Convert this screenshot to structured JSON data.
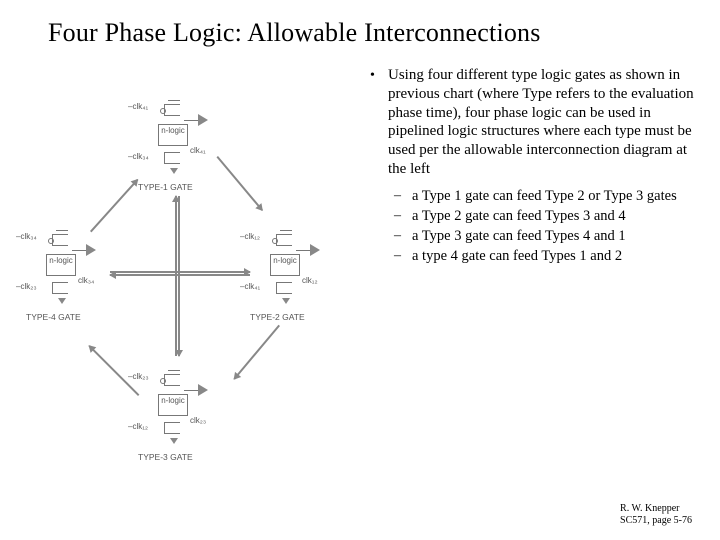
{
  "title": "Four Phase Logic:  Allowable Interconnections",
  "bullets": {
    "main": "Using four different type logic gates as shown in previous chart (where Type refers to the evaluation phase time), four phase logic can be used in pipelined logic structures where each type must be used per the allowable interconnection diagram at the left",
    "subs": [
      "a Type 1 gate can feed Type 2 or Type 3 gates",
      "a Type 2 gate can feed Types 3 and 4",
      "a Type 3 gate can feed Types 4 and 1",
      "a type 4 gate can feed Types 1 and 2"
    ]
  },
  "diagram": {
    "nblock": "n-logic",
    "gates": [
      {
        "label": "TYPE-1 GATE",
        "clk_top": "–clk₄₁",
        "clk_bot": "–clk₃₄",
        "clk_mid": "clk₄₁"
      },
      {
        "label": "TYPE-2 GATE",
        "clk_top": "–clk₁₂",
        "clk_bot": "–clk₄₁",
        "clk_mid": "clk₁₂"
      },
      {
        "label": "TYPE-3 GATE",
        "clk_top": "–clk₂₃",
        "clk_bot": "–clk₁₂",
        "clk_mid": "clk₂₃"
      },
      {
        "label": "TYPE-4 GATE",
        "clk_top": "–clk₃₄",
        "clk_bot": "–clk₂₃",
        "clk_mid": "clk₃₄"
      }
    ]
  },
  "footer": {
    "line1": "R. W. Knepper",
    "line2": "SC571, page 5-76"
  }
}
